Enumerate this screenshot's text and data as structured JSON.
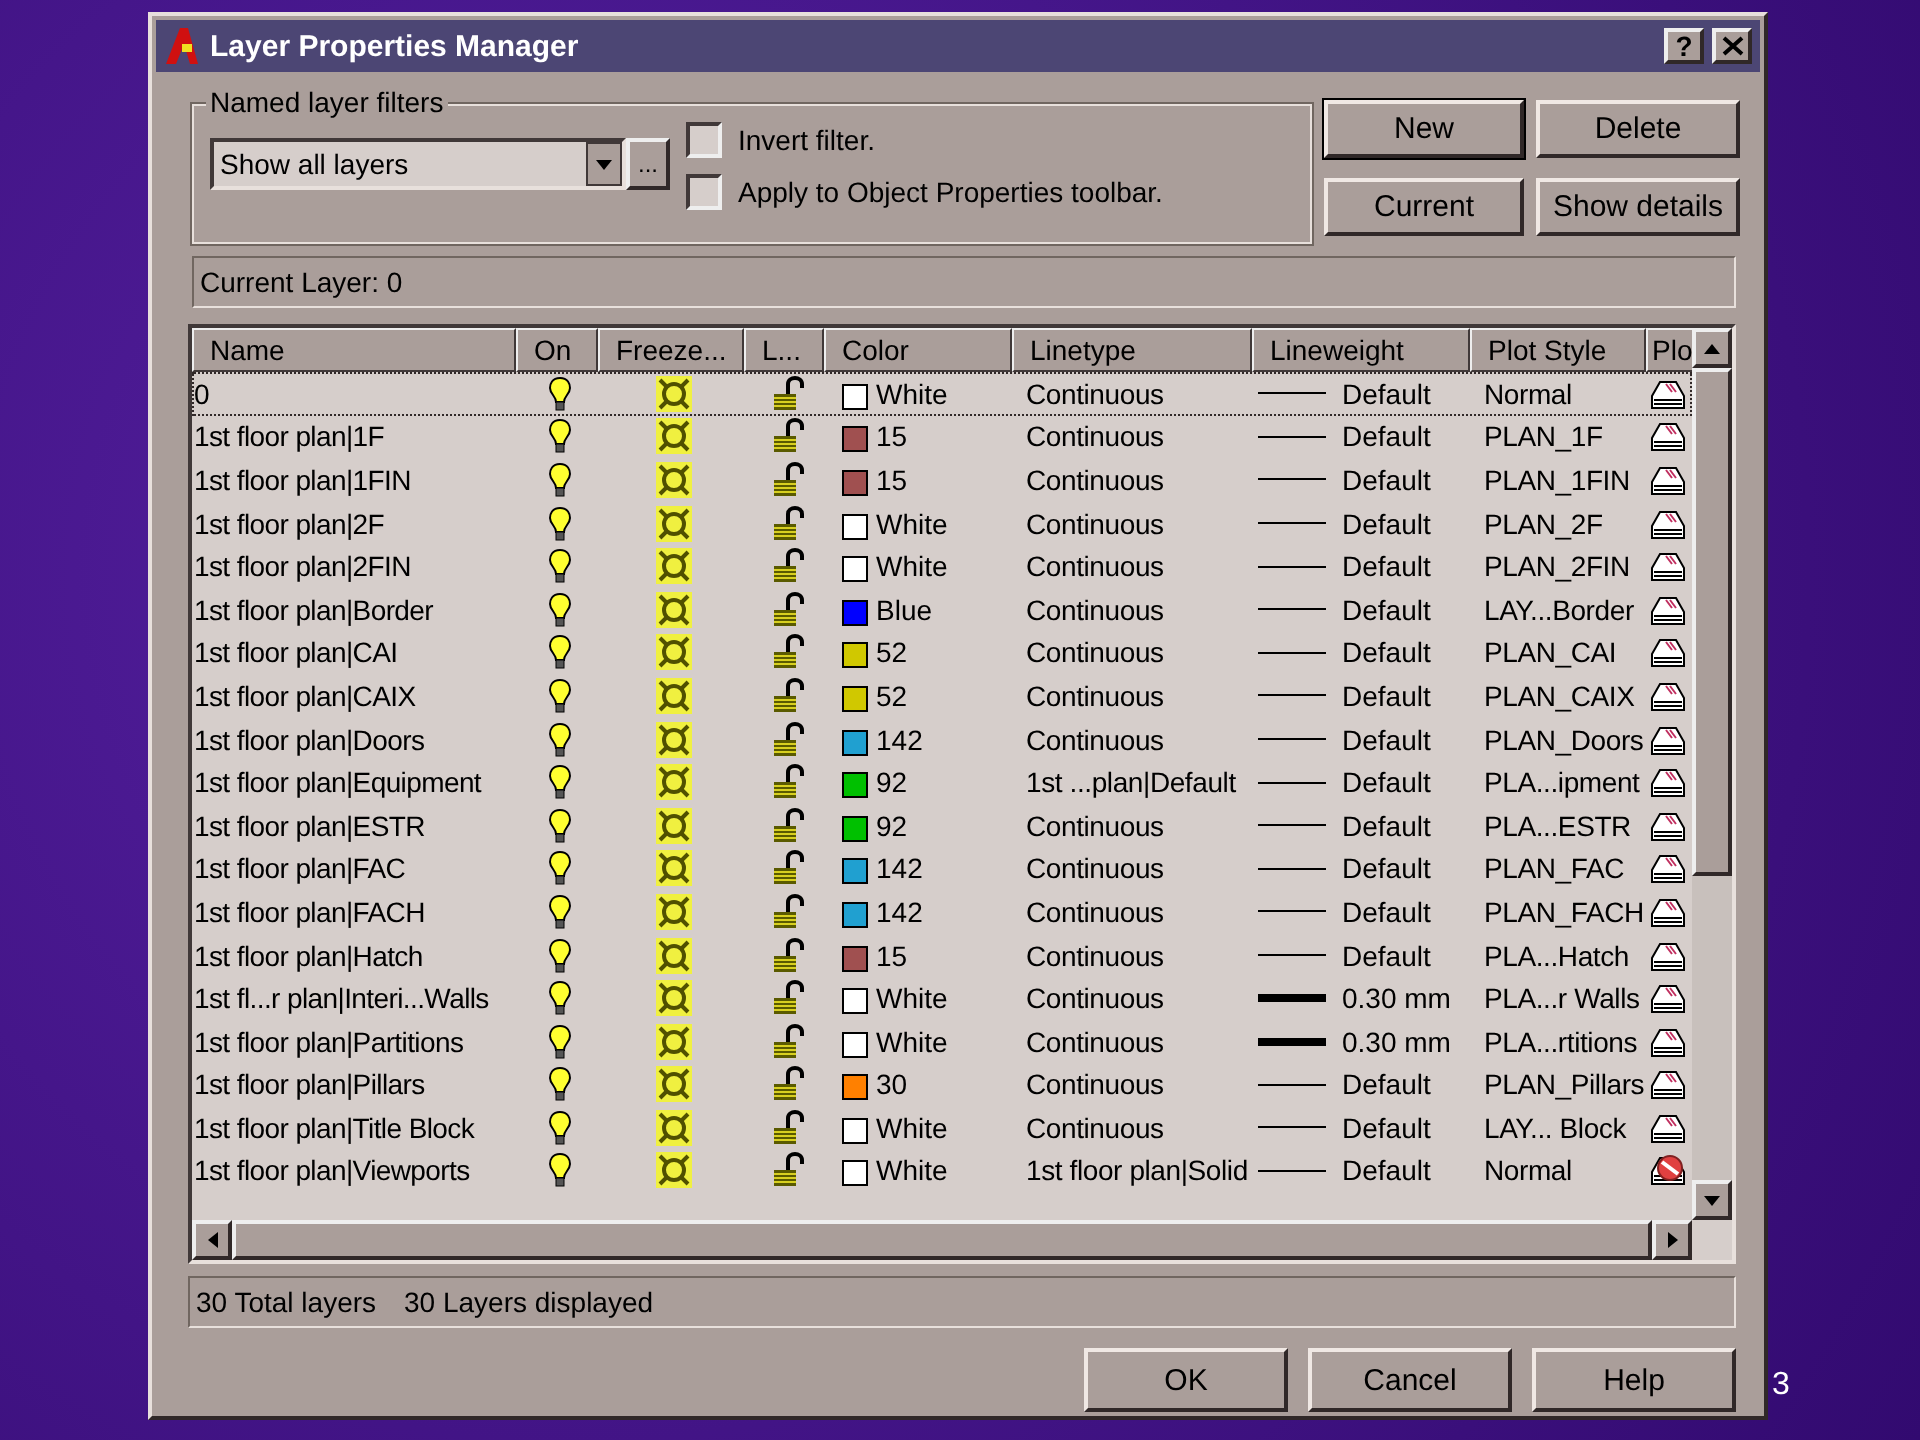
{
  "window": {
    "title": "Layer Properties Manager",
    "help_button": "?"
  },
  "filters": {
    "label": "Named layer filters",
    "value": "Show all layers",
    "browse_button": "...",
    "options": [
      {
        "label": "Invert filter.",
        "checked": false
      },
      {
        "label": "Apply to Object Properties toolbar.",
        "checked": false
      }
    ]
  },
  "top_buttons": [
    {
      "label": "New",
      "default": true
    },
    {
      "label": "Delete",
      "default": false
    },
    {
      "label": "Current",
      "default": false
    },
    {
      "label": "Show details",
      "default": false
    }
  ],
  "current_layer": "Current Layer:  0",
  "table": {
    "columns": [
      "Name",
      "On",
      "Freeze...",
      "L...",
      "Color",
      "Linetype",
      "Lineweight",
      "Plot Style",
      "Plo"
    ],
    "rows": [
      {
        "name": "0",
        "on": true,
        "frozen": false,
        "locked": false,
        "color": "#ffffff",
        "color_name": "White",
        "linetype": "Continuous",
        "heavy": false,
        "lineweight": "Default",
        "plot_style": "Normal",
        "plot": true,
        "selected": true
      },
      {
        "name": "1st floor plan|1F",
        "on": true,
        "frozen": false,
        "locked": false,
        "color": "#a05050",
        "color_name": "15",
        "linetype": "Continuous",
        "heavy": false,
        "lineweight": "Default",
        "plot_style": "PLAN_1F",
        "plot": true,
        "selected": false
      },
      {
        "name": "1st floor plan|1FIN",
        "on": true,
        "frozen": false,
        "locked": false,
        "color": "#a05050",
        "color_name": "15",
        "linetype": "Continuous",
        "heavy": false,
        "lineweight": "Default",
        "plot_style": "PLAN_1FIN",
        "plot": true,
        "selected": false
      },
      {
        "name": "1st floor plan|2F",
        "on": true,
        "frozen": false,
        "locked": false,
        "color": "#ffffff",
        "color_name": "White",
        "linetype": "Continuous",
        "heavy": false,
        "lineweight": "Default",
        "plot_style": "PLAN_2F",
        "plot": true,
        "selected": false
      },
      {
        "name": "1st floor plan|2FIN",
        "on": true,
        "frozen": false,
        "locked": false,
        "color": "#ffffff",
        "color_name": "White",
        "linetype": "Continuous",
        "heavy": false,
        "lineweight": "Default",
        "plot_style": "PLAN_2FIN",
        "plot": true,
        "selected": false
      },
      {
        "name": "1st floor plan|Border",
        "on": true,
        "frozen": false,
        "locked": false,
        "color": "#0000ff",
        "color_name": "Blue",
        "linetype": "Continuous",
        "heavy": false,
        "lineweight": "Default",
        "plot_style": "LAY...Border",
        "plot": true,
        "selected": false
      },
      {
        "name": "1st floor plan|CAI",
        "on": true,
        "frozen": false,
        "locked": false,
        "color": "#d0c800",
        "color_name": "52",
        "linetype": "Continuous",
        "heavy": false,
        "lineweight": "Default",
        "plot_style": "PLAN_CAI",
        "plot": true,
        "selected": false
      },
      {
        "name": "1st floor plan|CAIX",
        "on": true,
        "frozen": false,
        "locked": false,
        "color": "#d0c800",
        "color_name": "52",
        "linetype": "Continuous",
        "heavy": false,
        "lineweight": "Default",
        "plot_style": "PLAN_CAIX",
        "plot": true,
        "selected": false
      },
      {
        "name": "1st floor plan|Doors",
        "on": true,
        "frozen": false,
        "locked": false,
        "color": "#20a0d0",
        "color_name": "142",
        "linetype": "Continuous",
        "heavy": false,
        "lineweight": "Default",
        "plot_style": "PLAN_Doors",
        "plot": true,
        "selected": false
      },
      {
        "name": "1st floor plan|Equipment",
        "on": true,
        "frozen": false,
        "locked": false,
        "color": "#00c000",
        "color_name": "92",
        "linetype": "1st ...plan|Default",
        "heavy": false,
        "lineweight": "Default",
        "plot_style": "PLA...ipment",
        "plot": true,
        "selected": false
      },
      {
        "name": "1st floor plan|ESTR",
        "on": true,
        "frozen": false,
        "locked": false,
        "color": "#00c000",
        "color_name": "92",
        "linetype": "Continuous",
        "heavy": false,
        "lineweight": "Default",
        "plot_style": "PLA...ESTR",
        "plot": true,
        "selected": false
      },
      {
        "name": "1st floor plan|FAC",
        "on": true,
        "frozen": false,
        "locked": false,
        "color": "#20a0d0",
        "color_name": "142",
        "linetype": "Continuous",
        "heavy": false,
        "lineweight": "Default",
        "plot_style": "PLAN_FAC",
        "plot": true,
        "selected": false
      },
      {
        "name": "1st floor plan|FACH",
        "on": true,
        "frozen": false,
        "locked": false,
        "color": "#20a0d0",
        "color_name": "142",
        "linetype": "Continuous",
        "heavy": false,
        "lineweight": "Default",
        "plot_style": "PLAN_FACH",
        "plot": true,
        "selected": false
      },
      {
        "name": "1st floor plan|Hatch",
        "on": true,
        "frozen": false,
        "locked": false,
        "color": "#a05050",
        "color_name": "15",
        "linetype": "Continuous",
        "heavy": false,
        "lineweight": "Default",
        "plot_style": "PLA...Hatch",
        "plot": true,
        "selected": false
      },
      {
        "name": "1st fl...r plan|Interi...Walls",
        "on": true,
        "frozen": false,
        "locked": false,
        "color": "#ffffff",
        "color_name": "White",
        "linetype": "Continuous",
        "heavy": true,
        "lineweight": "0.30 mm",
        "plot_style": "PLA...r Walls",
        "plot": true,
        "selected": false
      },
      {
        "name": "1st floor plan|Partitions",
        "on": true,
        "frozen": false,
        "locked": false,
        "color": "#ffffff",
        "color_name": "White",
        "linetype": "Continuous",
        "heavy": true,
        "lineweight": "0.30 mm",
        "plot_style": "PLA...rtitions",
        "plot": true,
        "selected": false
      },
      {
        "name": "1st floor plan|Pillars",
        "on": true,
        "frozen": false,
        "locked": false,
        "color": "#ff8000",
        "color_name": "30",
        "linetype": "Continuous",
        "heavy": false,
        "lineweight": "Default",
        "plot_style": "PLAN_Pillars",
        "plot": true,
        "selected": false
      },
      {
        "name": "1st floor plan|Title Block",
        "on": true,
        "frozen": false,
        "locked": false,
        "color": "#ffffff",
        "color_name": "White",
        "linetype": "Continuous",
        "heavy": false,
        "lineweight": "Default",
        "plot_style": "LAY... Block",
        "plot": true,
        "selected": false
      },
      {
        "name": "1st floor plan|Viewports",
        "on": true,
        "frozen": false,
        "locked": false,
        "color": "#ffffff",
        "color_name": "White",
        "linetype": "1st floor plan|Solid",
        "heavy": false,
        "lineweight": "Default",
        "plot_style": "Normal",
        "plot": false,
        "selected": false
      }
    ]
  },
  "status": [
    "30 Total layers",
    "30 Layers displayed"
  ],
  "bottom_buttons": [
    {
      "label": "OK",
      "default": false
    },
    {
      "label": "Cancel",
      "default": false
    },
    {
      "label": "Help",
      "default": false
    }
  ],
  "slide_number": "3"
}
